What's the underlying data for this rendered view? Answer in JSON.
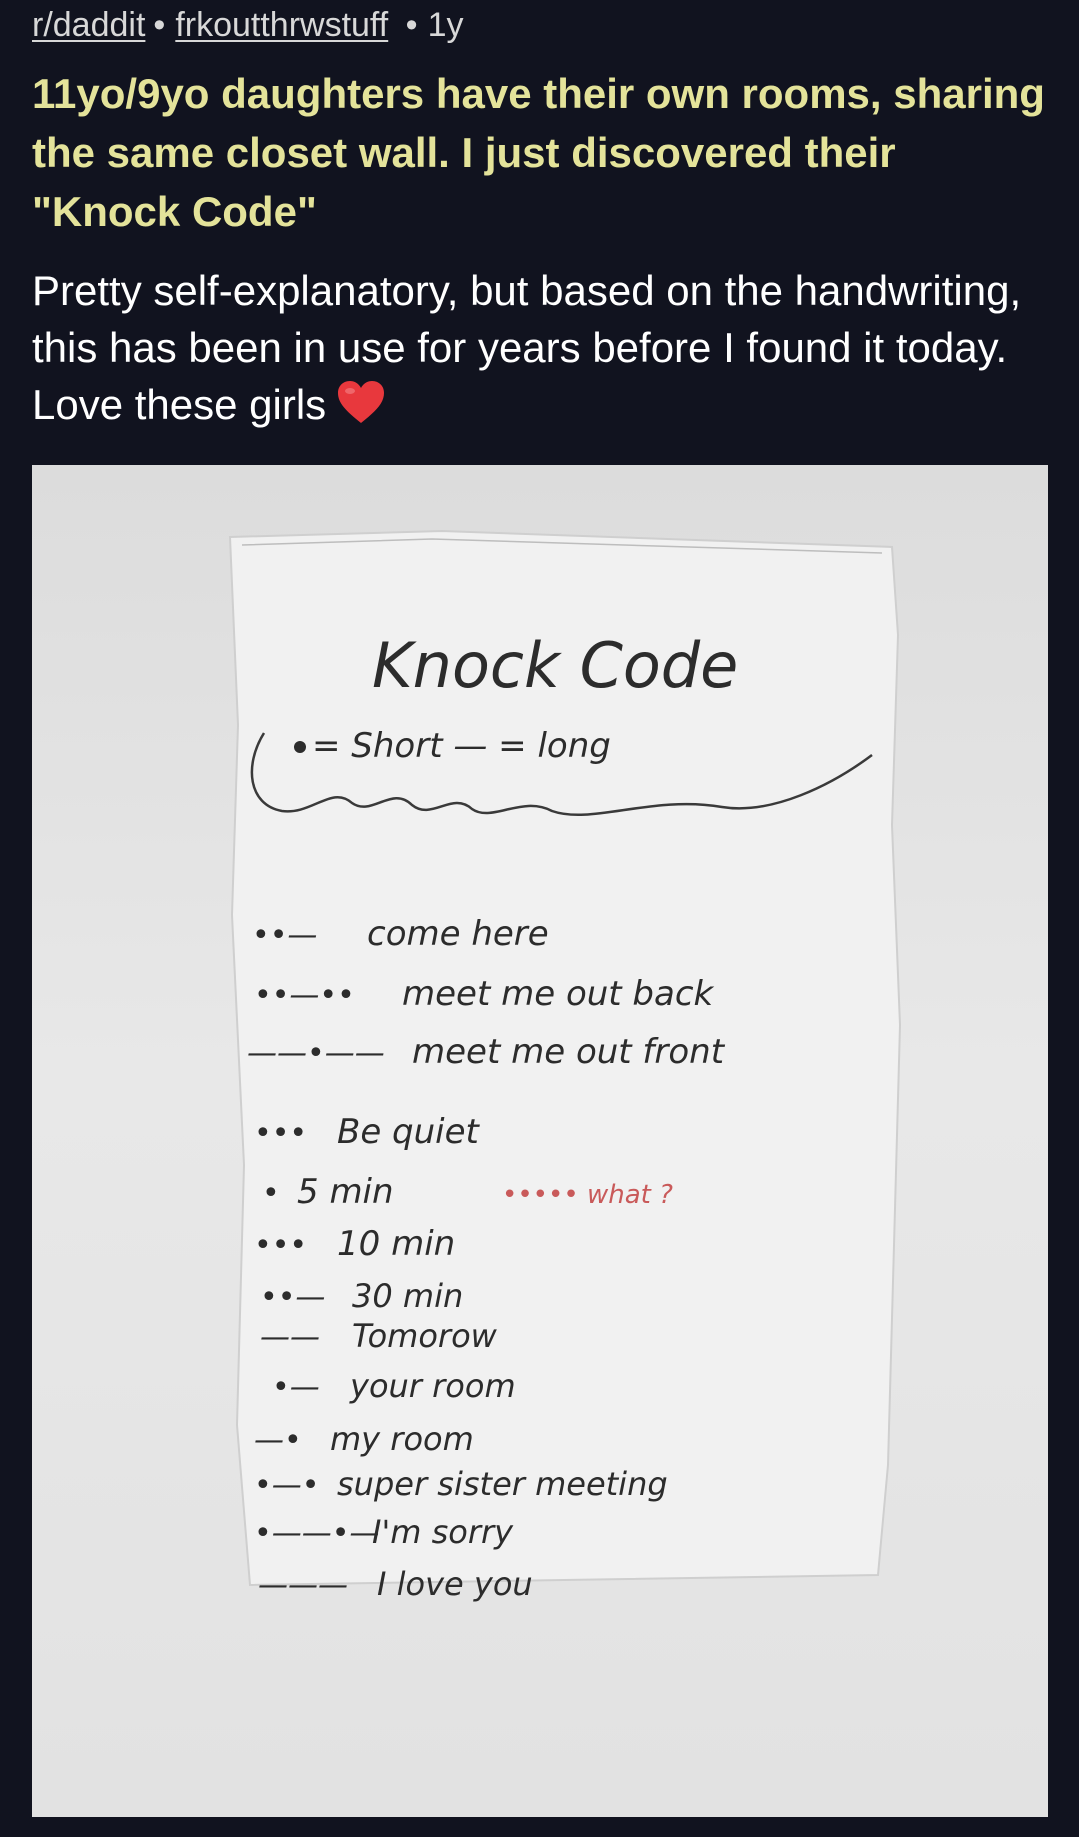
{
  "post": {
    "subreddit": "r/daddit",
    "author": "frkoutthrwstuff",
    "age": "1y",
    "title": "11yo/9yo daughters have their own rooms, sharing the same closet wall. I just discovered their \"Knock Code\"",
    "body": "Pretty self-explanatory, but based on the handwriting, this has been in use for years before I found it today. Love these girls"
  },
  "note": {
    "heading": "Knock Code",
    "legend": "= Short   — = long",
    "codes": [
      {
        "code": "••—",
        "meaning": "come here"
      },
      {
        "code": "••—••",
        "meaning": "meet me out back"
      },
      {
        "code": "——•——",
        "meaning": "meet me out front"
      },
      {
        "code": "•••",
        "meaning": "Be quiet"
      },
      {
        "code": "•",
        "meaning": "5 min"
      },
      {
        "code": "•••",
        "meaning": "10 min"
      },
      {
        "code": "••—",
        "meaning": "30 min"
      },
      {
        "code": "——",
        "meaning": "Tomorow"
      },
      {
        "code": "•—",
        "meaning": "your room"
      },
      {
        "code": "—•",
        "meaning": "my room"
      },
      {
        "code": "•—•",
        "meaning": "super sister meeting"
      },
      {
        "code": "•——•—",
        "meaning": "I'm sorry"
      },
      {
        "code": "———",
        "meaning": "I love you"
      }
    ],
    "annotation": "••••• what ?"
  },
  "colors": {
    "background": "#11131f",
    "title": "#e4e39a",
    "heart": "#e8383d"
  },
  "icons": {
    "heart": "red-heart-emoji-icon"
  }
}
